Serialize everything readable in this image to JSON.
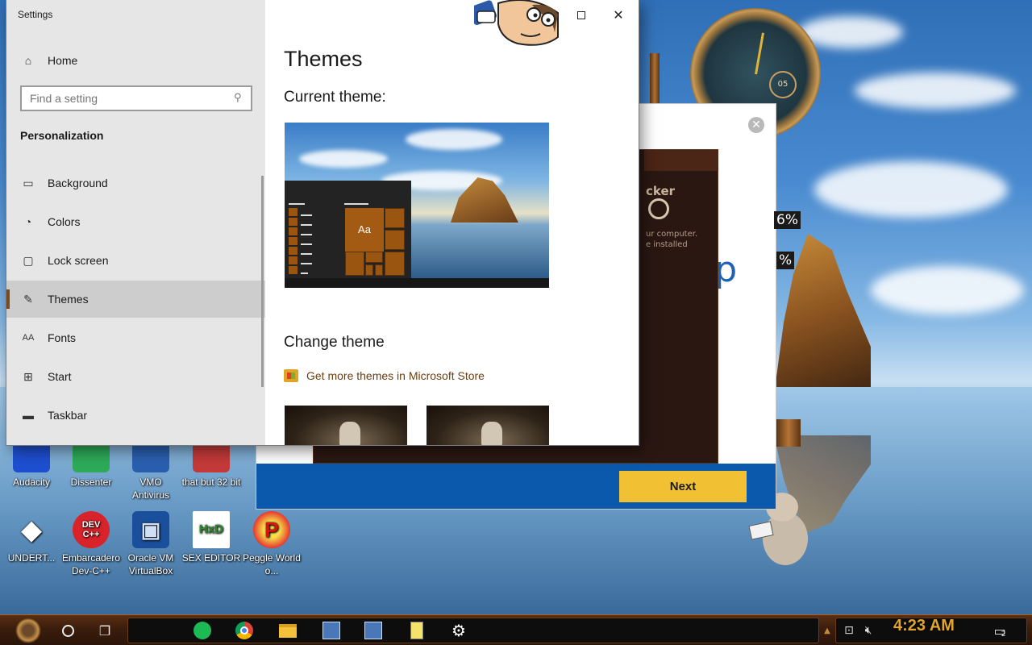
{
  "desktop": {
    "icons_row1": [
      {
        "label": "Audacity",
        "color": "#1e4fd0"
      },
      {
        "label": "Dissenter",
        "color": "#2dab58"
      },
      {
        "label": "VMO Antivirus",
        "color": "#2a5fb0"
      },
      {
        "label": "that but 32 bit",
        "color": "#c43a3a"
      }
    ],
    "icons_row2": [
      {
        "label": "UNDERT...",
        "glyph": "◆",
        "color": "#ffffff"
      },
      {
        "label": "Embarcadero Dev-C++",
        "glyph": "DEV C++",
        "color": "#d8232a"
      },
      {
        "label": "Oracle VM VirtualBox",
        "glyph": "▣",
        "color": "#1a4f9c"
      },
      {
        "label": "SEX EDITOR",
        "glyph": "HxD",
        "color": "#ffffff"
      },
      {
        "label": "Peggle World o...",
        "glyph": "P",
        "color": "#e8382e"
      }
    ],
    "clock_numeral": "05"
  },
  "installer": {
    "next_label": "Next",
    "close_symbol": "✕",
    "big_text": "ip"
  },
  "steampunk_widget": {
    "title_fragment": "cker",
    "text_lines": "ur computer.\ne installed",
    "percent_top": "6%",
    "percent_bottom": "%"
  },
  "settings": {
    "window_title": "Settings",
    "controls": {
      "minimize": "—",
      "close": "✕"
    },
    "home_label": "Home",
    "search_placeholder": "Find a setting",
    "category": "Personalization",
    "nav_items": [
      {
        "label": "Background",
        "icon": "image-icon"
      },
      {
        "label": "Colors",
        "icon": "palette-icon"
      },
      {
        "label": "Lock screen",
        "icon": "lock-screen-icon"
      },
      {
        "label": "Themes",
        "icon": "themes-icon",
        "active": true
      },
      {
        "label": "Fonts",
        "icon": "fonts-icon"
      },
      {
        "label": "Start",
        "icon": "start-icon"
      },
      {
        "label": "Taskbar",
        "icon": "taskbar-icon"
      }
    ],
    "page_title": "Themes",
    "current_theme_heading": "Current theme:",
    "preview_sample": "Aa",
    "change_theme_heading": "Change theme",
    "store_link": "Get more themes in Microsoft Store",
    "accent_color": "#9a5511"
  },
  "taskbar": {
    "time": "4:23 AM",
    "notification_count": "2",
    "pinned": [
      "cortana-circle-icon",
      "task-view-icon",
      "spotify-icon",
      "chrome-icon",
      "file-explorer-icon",
      "installer-app-icon",
      "installer-app-icon-2",
      "notepad-icon",
      "settings-gear-icon"
    ]
  }
}
